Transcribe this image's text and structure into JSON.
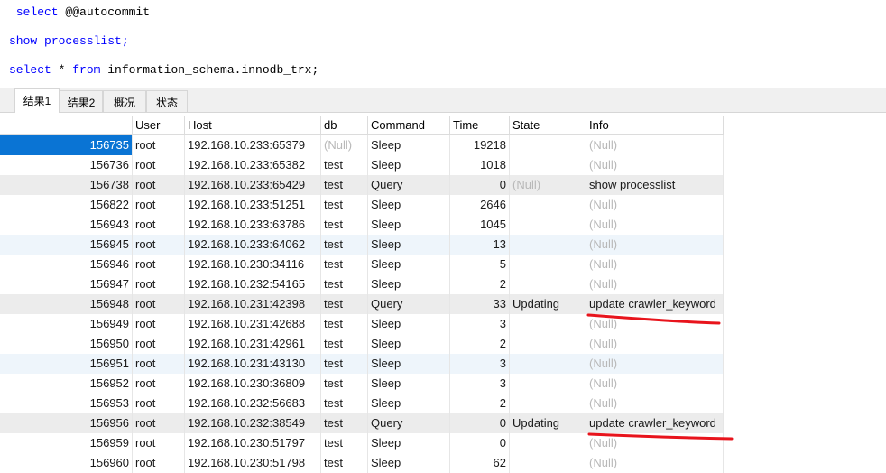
{
  "editor": {
    "lines": [
      [
        {
          "t": " select ",
          "kw": true
        },
        {
          "t": "@@autocommit",
          "kw": false
        }
      ],
      [
        {
          "t": "show ",
          "kw": true
        },
        {
          "t": "processlist;",
          "kw": true
        }
      ],
      [
        {
          "t": "select ",
          "kw": true
        },
        {
          "t": "* ",
          "kw": false
        },
        {
          "t": "from ",
          "kw": true
        },
        {
          "t": "information_schema.innodb_trx;",
          "kw": false
        }
      ]
    ]
  },
  "tabs": [
    "结果1",
    "结果2",
    "概况",
    "状态"
  ],
  "active_tab": 0,
  "table": {
    "columns": [
      "",
      "User",
      "Host",
      "db",
      "Command",
      "Time",
      "State",
      "Info"
    ],
    "rows": [
      [
        "156735",
        "root",
        "192.168.10.233:65379",
        "(Null)",
        "Sleep",
        "19218",
        "",
        "(Null)"
      ],
      [
        "156736",
        "root",
        "192.168.10.233:65382",
        "test",
        "Sleep",
        "1018",
        "",
        "(Null)"
      ],
      [
        "156738",
        "root",
        "192.168.10.233:65429",
        "test",
        "Query",
        "0",
        "(Null)",
        "show processlist"
      ],
      [
        "156822",
        "root",
        "192.168.10.233:51251",
        "test",
        "Sleep",
        "2646",
        "",
        "(Null)"
      ],
      [
        "156943",
        "root",
        "192.168.10.233:63786",
        "test",
        "Sleep",
        "1045",
        "",
        "(Null)"
      ],
      [
        "156945",
        "root",
        "192.168.10.233:64062",
        "test",
        "Sleep",
        "13",
        "",
        "(Null)"
      ],
      [
        "156946",
        "root",
        "192.168.10.230:34116",
        "test",
        "Sleep",
        "5",
        "",
        "(Null)"
      ],
      [
        "156947",
        "root",
        "192.168.10.232:54165",
        "test",
        "Sleep",
        "2",
        "",
        "(Null)"
      ],
      [
        "156948",
        "root",
        "192.168.10.231:42398",
        "test",
        "Query",
        "33",
        "Updating",
        "update crawler_keyword"
      ],
      [
        "156949",
        "root",
        "192.168.10.231:42688",
        "test",
        "Sleep",
        "3",
        "",
        "(Null)"
      ],
      [
        "156950",
        "root",
        "192.168.10.231:42961",
        "test",
        "Sleep",
        "2",
        "",
        "(Null)"
      ],
      [
        "156951",
        "root",
        "192.168.10.231:43130",
        "test",
        "Sleep",
        "3",
        "",
        "(Null)"
      ],
      [
        "156952",
        "root",
        "192.168.10.230:36809",
        "test",
        "Sleep",
        "3",
        "",
        "(Null)"
      ],
      [
        "156953",
        "root",
        "192.168.10.232:56683",
        "test",
        "Sleep",
        "2",
        "",
        "(Null)"
      ],
      [
        "156956",
        "root",
        "192.168.10.232:38549",
        "test",
        "Query",
        "0",
        "Updating",
        "update crawler_keyword"
      ],
      [
        "156959",
        "root",
        "192.168.10.230:51797",
        "test",
        "Sleep",
        "0",
        "",
        "(Null)"
      ],
      [
        "156960",
        "root",
        "192.168.10.230:51798",
        "test",
        "Sleep",
        "62",
        "",
        "(Null)"
      ]
    ],
    "selected_row": 0,
    "null_text": "(Null)"
  },
  "colors": {
    "keyword": "#0000ff",
    "selection": "#0a74d4",
    "annotation": "#e8141c"
  }
}
